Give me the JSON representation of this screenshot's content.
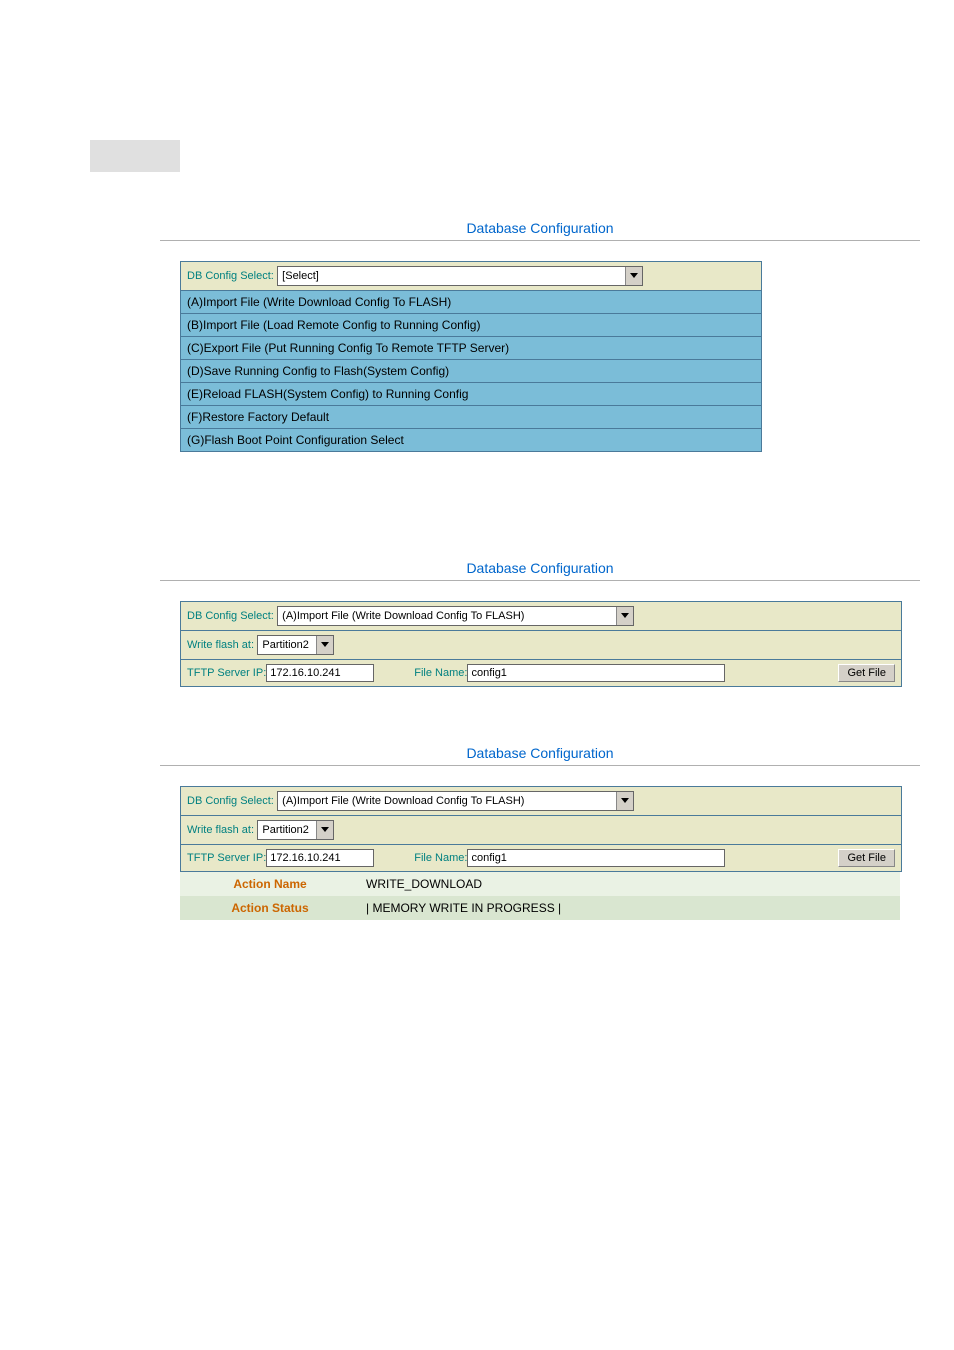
{
  "section1": {
    "title": "Database Configuration",
    "selectLabel": "DB Config Select:",
    "selectValue": "[Select]",
    "options": [
      "(A)Import File (Write Download Config To FLASH)",
      "(B)Import File (Load Remote Config to Running Config)",
      "(C)Export File (Put Running Config To Remote TFTP Server)",
      "(D)Save Running Config to Flash(System Config)",
      "(E)Reload FLASH(System Config) to Running Config",
      "(F)Restore Factory Default",
      "(G)Flash Boot Point Configuration Select"
    ]
  },
  "section2": {
    "title": "Database Configuration",
    "selectLabel": "DB Config Select:",
    "selectValue": "(A)Import File (Write Download Config To FLASH)",
    "writeFlashLabel": "Write flash at:",
    "writeFlashValue": "Partition2",
    "tftpLabel": "TFTP Server IP:",
    "tftpValue": "172.16.10.241",
    "fileNameLabel": "File Name:",
    "fileNameValue": "config1",
    "getFileBtn": "Get File"
  },
  "section3": {
    "title": "Database Configuration",
    "selectLabel": "DB Config Select:",
    "selectValue": "(A)Import File (Write Download Config To FLASH)",
    "writeFlashLabel": "Write flash at:",
    "writeFlashValue": "Partition2",
    "tftpLabel": "TFTP Server IP:",
    "tftpValue": "172.16.10.241",
    "fileNameLabel": "File Name:",
    "fileNameValue": "config1",
    "getFileBtn": "Get File",
    "actionNameLabel": "Action Name",
    "actionNameValue": "WRITE_DOWNLOAD",
    "actionStatusLabel": "Action Status",
    "actionStatusValue": "| MEMORY WRITE IN PROGRESS |"
  }
}
